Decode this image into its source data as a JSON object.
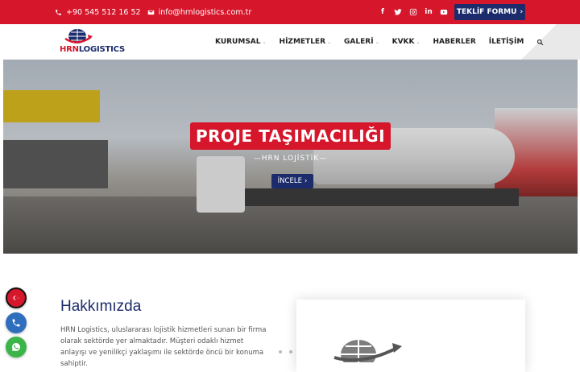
{
  "topbar": {
    "phone": "+90 545 512 16 52",
    "email": "info@hrnlogistics.com.tr",
    "social_icons": [
      "facebook-icon",
      "twitter-icon",
      "instagram-icon",
      "linkedin-icon",
      "youtube-icon"
    ],
    "cta_label": "TEKLİF FORMU",
    "background_color": "#d6162b",
    "cta_color": "#1b2b6b"
  },
  "header": {
    "logo_text_primary": "HRN",
    "logo_text_secondary": "LOGISTICS",
    "nav": [
      {
        "label": "KURUMSAL",
        "has_dropdown": true
      },
      {
        "label": "HİZMETLER",
        "has_dropdown": true
      },
      {
        "label": "GALERİ",
        "has_dropdown": true
      },
      {
        "label": "KVKK",
        "has_dropdown": true
      },
      {
        "label": "HABERLER",
        "has_dropdown": false
      },
      {
        "label": "İLETİŞİM",
        "has_dropdown": false
      }
    ],
    "search_icon": "search-icon"
  },
  "hero": {
    "title": "PROJE TAŞIMACILIĞI",
    "subtitle": "—HRN LOJİSTİK—",
    "button_label": "İNCELE"
  },
  "about": {
    "title": "Hakkımızda",
    "text": "HRN Logistics, uluslararası lojistik hizmetleri sunan bir firma olarak sektörde yer almaktadır. Müşteri odaklı hizmet anlayışı ve yenilikçi yaklaşımı ile sektörde öncü bir konuma sahiptir."
  },
  "floating": {
    "language_icon": "turkey-flag-icon",
    "phone_icon": "phone-icon",
    "whatsapp_icon": "whatsapp-icon"
  }
}
